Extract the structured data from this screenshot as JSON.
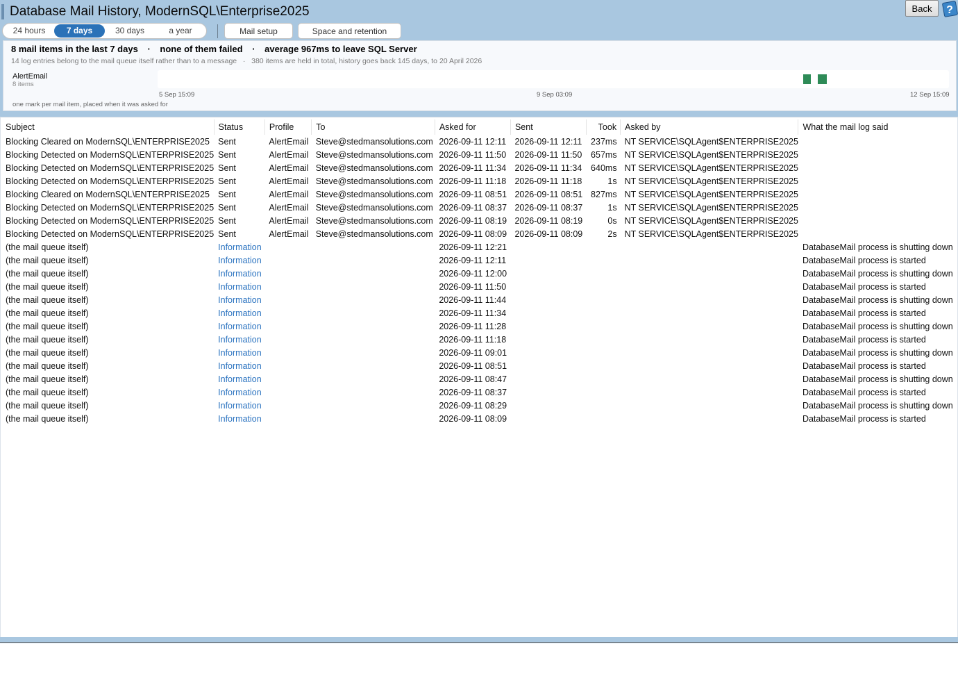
{
  "window_title": "Database Mail History, ModernSQL\\Enterprise2025",
  "back_label": "Back",
  "periods": [
    "24 hours",
    "7 days",
    "30 days",
    "a year"
  ],
  "active_period": "7 days",
  "buttons": {
    "mail_setup": "Mail setup",
    "space_retention": "Space and retention"
  },
  "summary": {
    "items": "8 mail items in the last 7 days",
    "sep1": "·",
    "failed": "none of them failed",
    "sep2": "·",
    "average": "average 967ms to leave SQL Server",
    "subline": "14 log entries belong to the mail queue itself rather than to a message   ·   380 items are held in total, history goes back 145 days, to 20 April 2026",
    "lane_name": "AlertEmail",
    "lane_count": "8 items",
    "axis_start": "5 Sep 15:09",
    "axis_mid": "9 Sep 03:09",
    "axis_end": "12 Sep 15:09",
    "footnote": "one mark per mail item, placed when it was asked for",
    "timeline_marks": [
      {
        "at": "2026-09-11 08:09"
      },
      {
        "at": "2026-09-11 08:19"
      },
      {
        "at": "2026-09-11 08:37"
      },
      {
        "at": "2026-09-11 08:51"
      },
      {
        "at": "2026-09-11 11:18"
      },
      {
        "at": "2026-09-11 11:34"
      },
      {
        "at": "2026-09-11 11:50"
      },
      {
        "at": "2026-09-11 12:11"
      }
    ],
    "mark_color": "#2e8b57"
  },
  "columns": {
    "subject": "Subject",
    "status": "Status",
    "profile": "Profile",
    "to": "To",
    "asked_for": "Asked for",
    "sent": "Sent",
    "took": "Took",
    "asked_by": "Asked by",
    "log": "What the mail log said"
  },
  "rows": [
    [
      "Blocking Cleared on ModernSQL\\ENTERPRISE2025",
      "Sent",
      "AlertEmail",
      "Steve@stedmansolutions.com",
      "2026-09-11 12:11",
      "2026-09-11 12:11",
      "237ms",
      "NT SERVICE\\SQLAgent$ENTERPRISE2025",
      ""
    ],
    [
      "Blocking Detected on ModernSQL\\ENTERPRISE2025",
      "Sent",
      "AlertEmail",
      "Steve@stedmansolutions.com",
      "2026-09-11 11:50",
      "2026-09-11 11:50",
      "657ms",
      "NT SERVICE\\SQLAgent$ENTERPRISE2025",
      ""
    ],
    [
      "Blocking Detected on ModernSQL\\ENTERPRISE2025",
      "Sent",
      "AlertEmail",
      "Steve@stedmansolutions.com",
      "2026-09-11 11:34",
      "2026-09-11 11:34",
      "640ms",
      "NT SERVICE\\SQLAgent$ENTERPRISE2025",
      ""
    ],
    [
      "Blocking Detected on ModernSQL\\ENTERPRISE2025",
      "Sent",
      "AlertEmail",
      "Steve@stedmansolutions.com",
      "2026-09-11 11:18",
      "2026-09-11 11:18",
      "1s",
      "NT SERVICE\\SQLAgent$ENTERPRISE2025",
      ""
    ],
    [
      "Blocking Cleared on ModernSQL\\ENTERPRISE2025",
      "Sent",
      "AlertEmail",
      "Steve@stedmansolutions.com",
      "2026-09-11 08:51",
      "2026-09-11 08:51",
      "827ms",
      "NT SERVICE\\SQLAgent$ENTERPRISE2025",
      ""
    ],
    [
      "Blocking Detected on ModernSQL\\ENTERPRISE2025",
      "Sent",
      "AlertEmail",
      "Steve@stedmansolutions.com",
      "2026-09-11 08:37",
      "2026-09-11 08:37",
      "1s",
      "NT SERVICE\\SQLAgent$ENTERPRISE2025",
      ""
    ],
    [
      "Blocking Detected on ModernSQL\\ENTERPRISE2025",
      "Sent",
      "AlertEmail",
      "Steve@stedmansolutions.com",
      "2026-09-11 08:19",
      "2026-09-11 08:19",
      "0s",
      "NT SERVICE\\SQLAgent$ENTERPRISE2025",
      ""
    ],
    [
      "Blocking Detected on ModernSQL\\ENTERPRISE2025",
      "Sent",
      "AlertEmail",
      "Steve@stedmansolutions.com",
      "2026-09-11 08:09",
      "2026-09-11 08:09",
      "2s",
      "NT SERVICE\\SQLAgent$ENTERPRISE2025",
      ""
    ],
    [
      "(the mail queue itself)",
      "Information",
      "",
      "",
      "2026-09-11 12:21",
      "",
      "",
      "",
      "DatabaseMail process is shutting down"
    ],
    [
      "(the mail queue itself)",
      "Information",
      "",
      "",
      "2026-09-11 12:11",
      "",
      "",
      "",
      "DatabaseMail process is started"
    ],
    [
      "(the mail queue itself)",
      "Information",
      "",
      "",
      "2026-09-11 12:00",
      "",
      "",
      "",
      "DatabaseMail process is shutting down"
    ],
    [
      "(the mail queue itself)",
      "Information",
      "",
      "",
      "2026-09-11 11:50",
      "",
      "",
      "",
      "DatabaseMail process is started"
    ],
    [
      "(the mail queue itself)",
      "Information",
      "",
      "",
      "2026-09-11 11:44",
      "",
      "",
      "",
      "DatabaseMail process is shutting down"
    ],
    [
      "(the mail queue itself)",
      "Information",
      "",
      "",
      "2026-09-11 11:34",
      "",
      "",
      "",
      "DatabaseMail process is started"
    ],
    [
      "(the mail queue itself)",
      "Information",
      "",
      "",
      "2026-09-11 11:28",
      "",
      "",
      "",
      "DatabaseMail process is shutting down"
    ],
    [
      "(the mail queue itself)",
      "Information",
      "",
      "",
      "2026-09-11 11:18",
      "",
      "",
      "",
      "DatabaseMail process is started"
    ],
    [
      "(the mail queue itself)",
      "Information",
      "",
      "",
      "2026-09-11 09:01",
      "",
      "",
      "",
      "DatabaseMail process is shutting down"
    ],
    [
      "(the mail queue itself)",
      "Information",
      "",
      "",
      "2026-09-11 08:51",
      "",
      "",
      "",
      "DatabaseMail process is started"
    ],
    [
      "(the mail queue itself)",
      "Information",
      "",
      "",
      "2026-09-11 08:47",
      "",
      "",
      "",
      "DatabaseMail process is shutting down"
    ],
    [
      "(the mail queue itself)",
      "Information",
      "",
      "",
      "2026-09-11 08:37",
      "",
      "",
      "",
      "DatabaseMail process is started"
    ],
    [
      "(the mail queue itself)",
      "Information",
      "",
      "",
      "2026-09-11 08:29",
      "",
      "",
      "",
      "DatabaseMail process is shutting down"
    ],
    [
      "(the mail queue itself)",
      "Information",
      "",
      "",
      "2026-09-11 08:09",
      "",
      "",
      "",
      "DatabaseMail process is started"
    ]
  ],
  "colors": {
    "header_bg": "#a9c7e0",
    "active_tab": "#2b72b8",
    "info_text": "#2b73c0",
    "mark": "#2e8b57"
  }
}
